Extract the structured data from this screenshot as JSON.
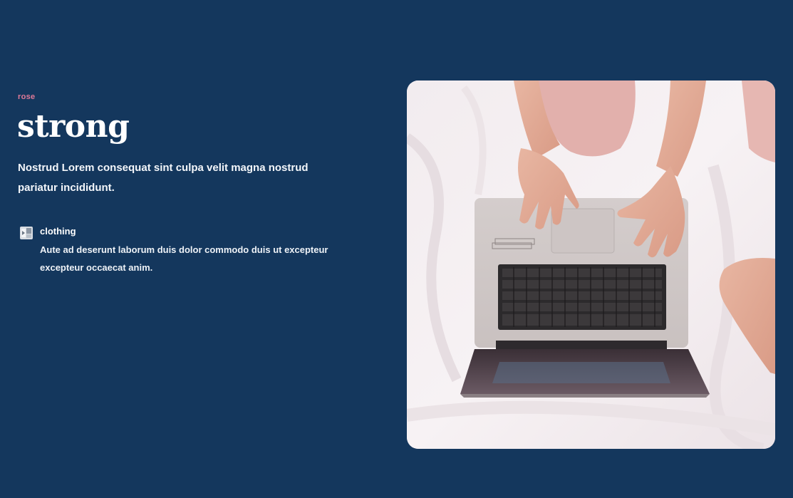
{
  "hero": {
    "eyebrow": "rose",
    "headline": "strong",
    "lead": "Nostrud Lorem consequat sint culpa velit magna nostrud pariatur incididunt."
  },
  "feature": {
    "icon": "clothing-thumbnail-icon",
    "title": "clothing",
    "description": "Aute ad deserunt laborum duis dolor commodo duis ut excepteur excepteur occaecat anim."
  },
  "image": {
    "subject": "laptop-on-bed-photo"
  },
  "colors": {
    "background": "#14375d",
    "accent": "#e07a98",
    "text": "#ffffff"
  }
}
